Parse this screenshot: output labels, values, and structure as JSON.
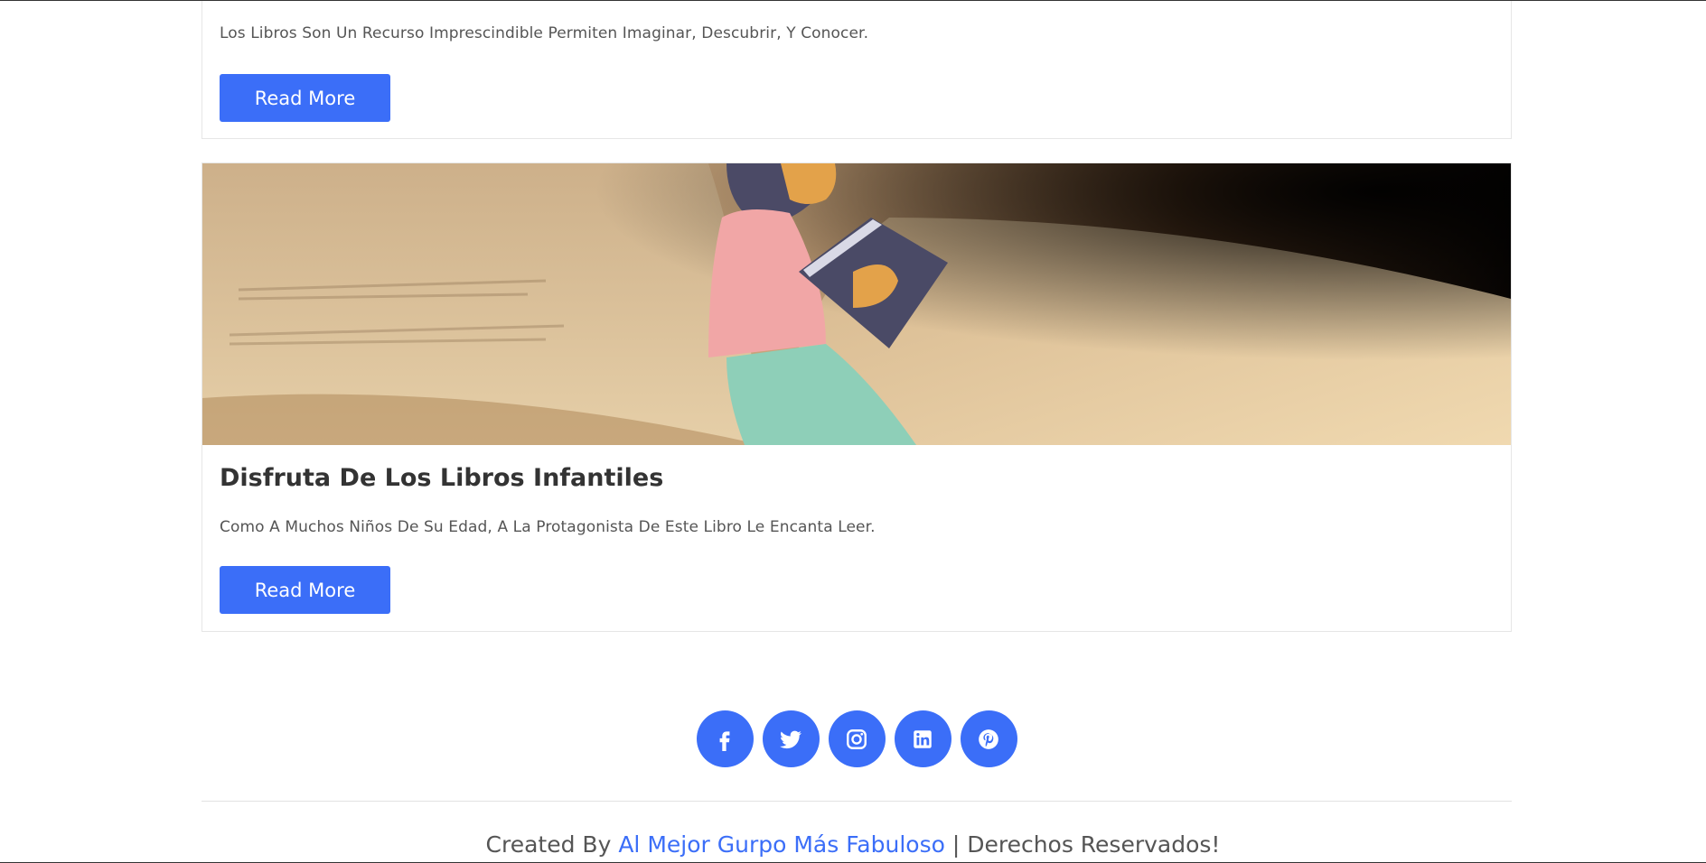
{
  "cards": [
    {
      "text": "Los Libros Son Un Recurso Imprescindible Permiten Imaginar, Descubrir, Y Conocer.",
      "button_label": "Read More"
    },
    {
      "title": "Disfruta De Los Libros Infantiles",
      "text": "Como A Muchos Niños De Su Edad, A La Protagonista De Este Libro Le Encanta Leer.",
      "button_label": "Read More",
      "image_icon": "open-book-reading-girl-image"
    }
  ],
  "social": {
    "icons": [
      "facebook-icon",
      "twitter-icon",
      "instagram-icon",
      "linkedin-icon",
      "pinterest-icon"
    ],
    "color": "#3b6ef8"
  },
  "footer": {
    "prefix": "Created By ",
    "link": "Al Mejor Gurpo Más Fabuloso",
    "suffix": " | Derechos Reservados!"
  },
  "colors": {
    "accent": "#3b6ef8",
    "text": "#555555",
    "heading": "#333333"
  }
}
